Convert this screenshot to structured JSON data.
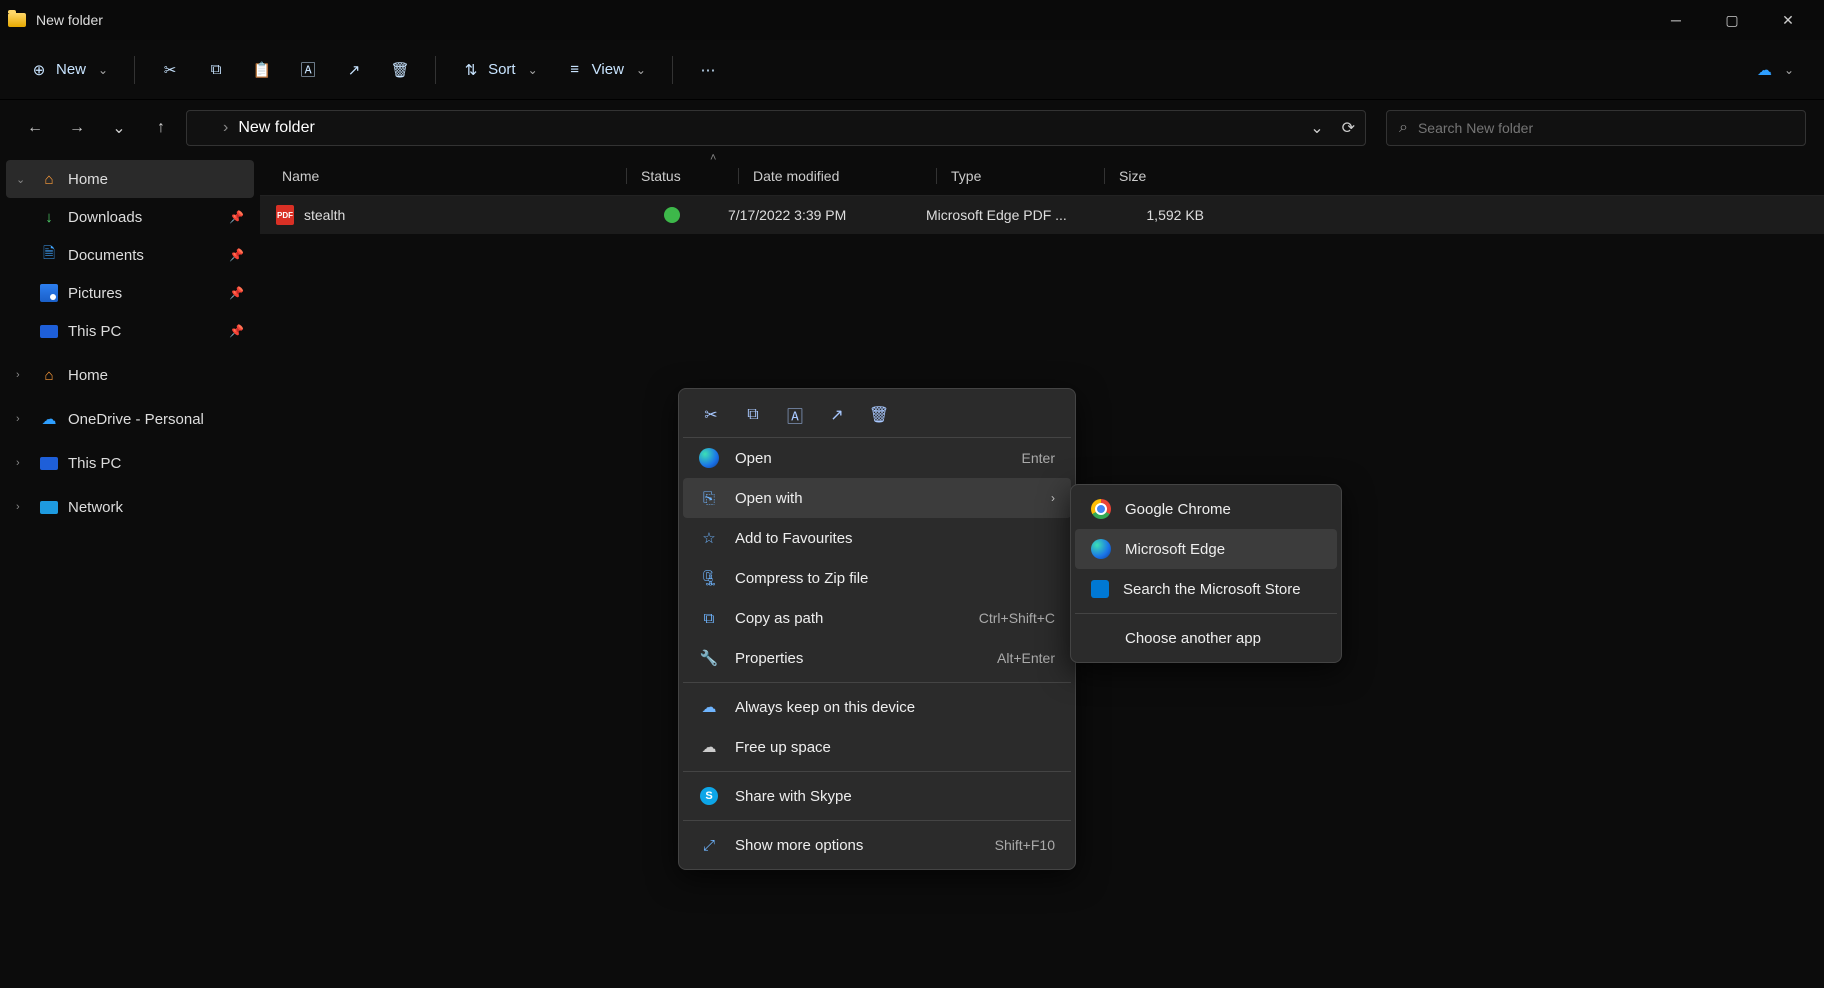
{
  "window": {
    "title": "New folder"
  },
  "toolbar": {
    "new": "New",
    "sort": "Sort",
    "view": "View"
  },
  "breadcrumb": {
    "location": "New folder"
  },
  "search": {
    "placeholder": "Search New folder"
  },
  "sidebar": {
    "quick": [
      {
        "label": "Home"
      },
      {
        "label": "Downloads"
      },
      {
        "label": "Documents"
      },
      {
        "label": "Pictures"
      },
      {
        "label": "This PC"
      }
    ],
    "groups": [
      {
        "label": "Home"
      },
      {
        "label": "OneDrive - Personal"
      },
      {
        "label": "This PC"
      },
      {
        "label": "Network"
      }
    ]
  },
  "columns": {
    "name": "Name",
    "status": "Status",
    "date": "Date modified",
    "type": "Type",
    "size": "Size"
  },
  "files": [
    {
      "name": "stealth",
      "date": "7/17/2022 3:39 PM",
      "type": "Microsoft Edge PDF ...",
      "size": "1,592 KB"
    }
  ],
  "context": {
    "open": "Open",
    "open_sc": "Enter",
    "openwith": "Open with",
    "fav": "Add to Favourites",
    "zip": "Compress to Zip file",
    "copypath": "Copy as path",
    "copypath_sc": "Ctrl+Shift+C",
    "props": "Properties",
    "props_sc": "Alt+Enter",
    "keep": "Always keep on this device",
    "free": "Free up space",
    "skype": "Share with Skype",
    "more": "Show more options",
    "more_sc": "Shift+F10"
  },
  "submenu": {
    "chrome": "Google Chrome",
    "edge": "Microsoft Edge",
    "store": "Search the Microsoft Store",
    "choose": "Choose another app"
  }
}
